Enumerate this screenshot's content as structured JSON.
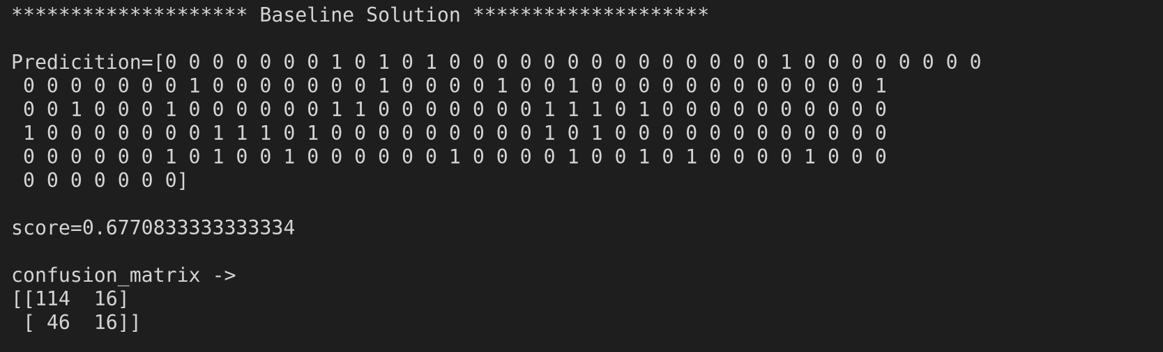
{
  "terminal": {
    "header": "******************** Baseline Solution ********************",
    "prediction_lines": [
      "Predicition=[0 0 0 0 0 0 0 1 0 1 0 1 0 0 0 0 0 0 0 0 0 0 0 0 0 0 1 0 0 0 0 0 0 0 0",
      " 0 0 0 0 0 0 0 1 0 0 0 0 0 0 0 1 0 0 0 0 1 0 0 1 0 0 0 0 0 0 0 0 0 0 0 0 1",
      " 0 0 1 0 0 0 1 0 0 0 0 0 0 1 1 0 0 0 0 0 0 0 1 1 1 0 1 0 0 0 0 0 0 0 0 0 0",
      " 1 0 0 0 0 0 0 0 1 1 1 0 1 0 0 0 0 0 0 0 0 0 1 0 1 0 0 0 0 0 0 0 0 0 0 0 0",
      " 0 0 0 0 0 0 1 0 1 0 0 1 0 0 0 0 0 0 1 0 0 0 0 1 0 0 1 0 1 0 0 0 0 1 0 0 0",
      " 0 0 0 0 0 0 0]"
    ],
    "score_line": "score=0.6770833333333334",
    "confusion_label": "confusion_matrix ->",
    "matrix_lines": [
      "[[114  16]",
      " [ 46  16]]"
    ]
  }
}
